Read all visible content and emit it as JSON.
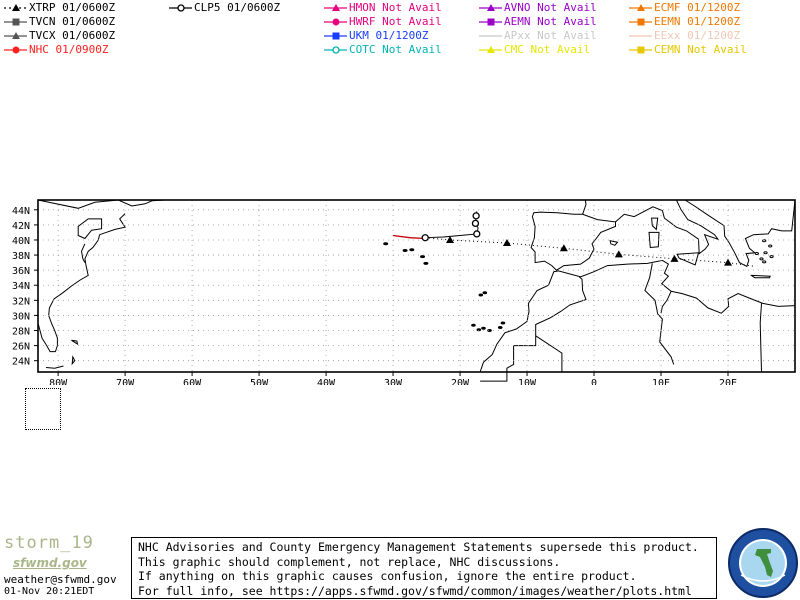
{
  "legend": [
    {
      "label": "XTRP 01/0600Z",
      "color": "#000000",
      "marker": "triangle",
      "line": "dotted",
      "faded": false
    },
    {
      "label": "TVCN 01/0600Z",
      "color": "#555555",
      "marker": "square",
      "line": "solid",
      "faded": false
    },
    {
      "label": "TVCX 01/0600Z",
      "color": "#555555",
      "marker": "triangle",
      "line": "solid",
      "faded": false
    },
    {
      "label": "NHC 01/0900Z",
      "color": "#ff2020",
      "marker": "circle",
      "line": "solid",
      "faded": false
    },
    {
      "label": "CLP5 01/0600Z",
      "color": "#000000",
      "marker": "ring",
      "line": "solid",
      "faded": false
    },
    {
      "label": "HMON Not Avail",
      "color": "#e6007e",
      "marker": "triangle",
      "line": "solid",
      "faded": false
    },
    {
      "label": "HWRF Not Avail",
      "color": "#e6007e",
      "marker": "circle",
      "line": "solid",
      "faded": false
    },
    {
      "label": "UKM  01/1200Z",
      "color": "#1a3cff",
      "marker": "square",
      "line": "solid",
      "faded": false
    },
    {
      "label": "COTC Not Avail",
      "color": "#00b4b4",
      "marker": "ring",
      "line": "solid",
      "faded": false
    },
    {
      "label": "AVNO Not Avail",
      "color": "#9a00c8",
      "marker": "triangle",
      "line": "solid",
      "faded": false
    },
    {
      "label": "AEMN Not Avail",
      "color": "#9a00c8",
      "marker": "square",
      "line": "solid",
      "faded": false
    },
    {
      "label": "APxx  Not Avail",
      "color": "#c8c8c8",
      "marker": "none",
      "line": "solid",
      "faded": true
    },
    {
      "label": "CMC   Not Avail",
      "color": "#e6e600",
      "marker": "triangle",
      "line": "solid",
      "faded": false
    },
    {
      "label": "ECMF 01/1200Z",
      "color": "#f07800",
      "marker": "triangle",
      "line": "solid",
      "faded": false
    },
    {
      "label": "EEMN 01/1200Z",
      "color": "#f07800",
      "marker": "square",
      "line": "solid",
      "faded": false
    },
    {
      "label": "EExx  01/1200Z",
      "color": "#f0c8b4",
      "marker": "none",
      "line": "solid",
      "faded": true
    },
    {
      "label": "CEMN Not Avail",
      "color": "#e6c800",
      "marker": "square",
      "line": "solid",
      "faded": false
    }
  ],
  "map": {
    "lat_labels": [
      "44N",
      "42N",
      "40N",
      "38N",
      "36N",
      "34N",
      "32N",
      "30N",
      "28N",
      "26N",
      "24N"
    ],
    "lon_labels": [
      "80W",
      "70W",
      "60W",
      "50W",
      "40W",
      "30W",
      "20W",
      "10W",
      "0",
      "10E",
      "20E"
    ],
    "nhc_track": [
      [
        -30,
        40.6
      ],
      [
        -27.5,
        40.3
      ],
      [
        -25.2,
        40.2
      ]
    ],
    "xtrp_track": [
      [
        -25.2,
        40.3
      ],
      [
        -21.5,
        40.0
      ],
      [
        -13,
        39.6
      ],
      [
        -4.5,
        38.9
      ],
      [
        3.7,
        38.1
      ],
      [
        12,
        37.5
      ],
      [
        20,
        37.0
      ],
      [
        24,
        36.5
      ]
    ],
    "clp5_track": [
      [
        -25.2,
        40.3
      ],
      [
        -22.5,
        40.4
      ],
      [
        -20.0,
        40.6
      ],
      [
        -17.5,
        40.8
      ],
      [
        -17.3,
        41.6
      ],
      [
        -17.7,
        42.2
      ],
      [
        -17.6,
        43.0
      ],
      [
        -17.5,
        43.8
      ]
    ],
    "xtrp_markers": [
      [
        -21.5,
        40.0
      ],
      [
        -13,
        39.6
      ],
      [
        -4.5,
        38.9
      ],
      [
        3.7,
        38.1
      ],
      [
        12,
        37.5
      ],
      [
        20,
        37.0
      ]
    ],
    "clp5_markers": [
      [
        -25.2,
        40.3
      ],
      [
        -17.5,
        40.8
      ],
      [
        -17.7,
        42.2
      ],
      [
        -17.6,
        43.2
      ]
    ]
  },
  "footer": {
    "storm_id": "storm_19",
    "site_logo": "sfwmd.gov",
    "email": "weather@sfwmd.gov",
    "timestamp": "01-Nov 20:21EDT",
    "disclaimer": [
      "NHC Advisories and County Emergency Management Statements supersede this product.",
      "This graphic should complement, not replace, NHC discussions.",
      "If anything on this graphic causes confusion, ignore the entire product.",
      "For full info, see  https://apps.sfwmd.gov/sfwmd/common/images/weather/plots.html"
    ],
    "seal_text": "SOUTH FLORIDA WATER MANAGEMENT DISTRICT"
  }
}
